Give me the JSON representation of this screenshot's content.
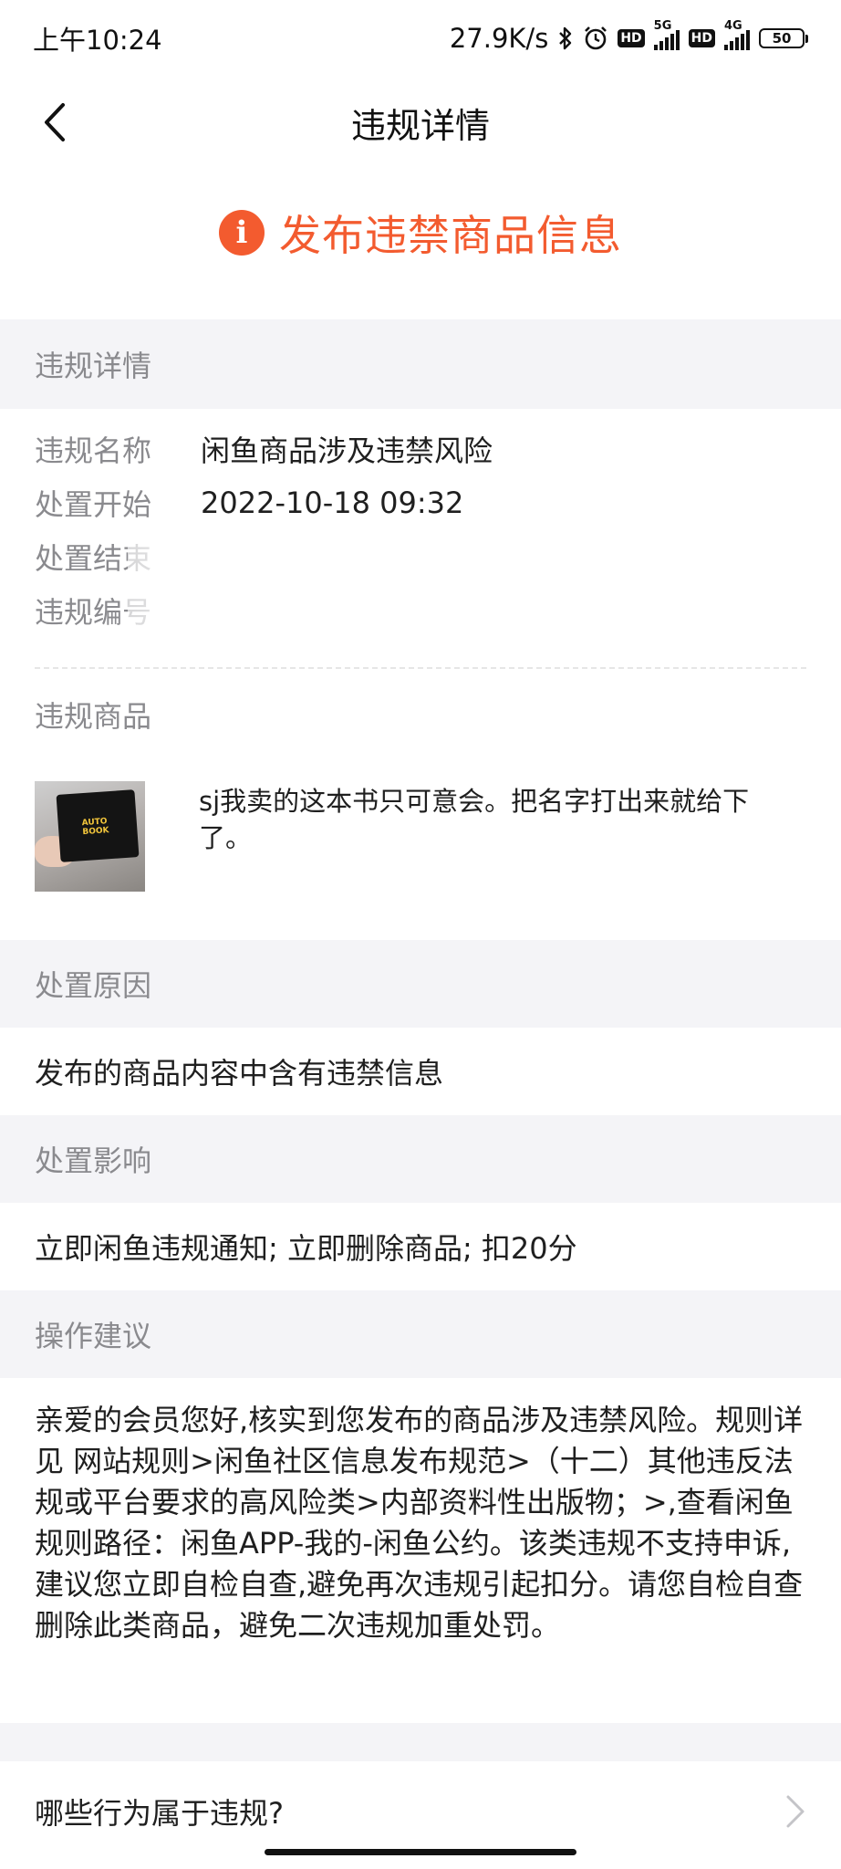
{
  "status_bar": {
    "time": "上午10:24",
    "network_speed": "27.9K/s",
    "hd1": "HD",
    "net1": "5G",
    "hd2": "HD",
    "net2": "4G",
    "battery": "50",
    "icons": [
      "bluetooth-icon",
      "alarm-icon"
    ]
  },
  "nav": {
    "title": "违规详情",
    "back_icon": "chevron-left-icon"
  },
  "alert": {
    "icon": "info-icon",
    "title": "发布违禁商品信息",
    "color": "#f35b2f"
  },
  "details_section": {
    "header": "违规详情",
    "rows": [
      {
        "label": "违规名称",
        "value": "闲鱼商品涉及违禁风险"
      },
      {
        "label": "处置开始",
        "value": "2022-10-18 09:32"
      },
      {
        "label": "处置结束",
        "value": ""
      },
      {
        "label": "违规编号",
        "value": ""
      }
    ]
  },
  "goods_section": {
    "header": "违规商品",
    "item": {
      "title": "sj我卖的这本书只可意会。把名字打出来就给下了。",
      "thumb_text": "AUTO\nBOOK"
    }
  },
  "reason_section": {
    "header": "处置原因",
    "text": "发布的商品内容中含有违禁信息"
  },
  "impact_section": {
    "header": "处置影响",
    "text": "立即闲鱼违规通知; 立即删除商品; 扣20分"
  },
  "advice_section": {
    "header": "操作建议",
    "text": "亲爱的会员您好,核实到您发布的商品涉及违禁风险。规则详见 网站规则>闲鱼社区信息发布规范>（十二）其他违反法规或平台要求的高风险类>内部资料性出版物；>,查看闲鱼规则路径：闲鱼APP-我的-闲鱼公约。该类违规不支持申诉,建议您立即自检自查,避免再次违规引起扣分。请您自检自查删除此类商品，避免二次违规加重处罚。"
  },
  "faq": {
    "label": "哪些行为属于违规?",
    "icon": "chevron-right-icon"
  }
}
